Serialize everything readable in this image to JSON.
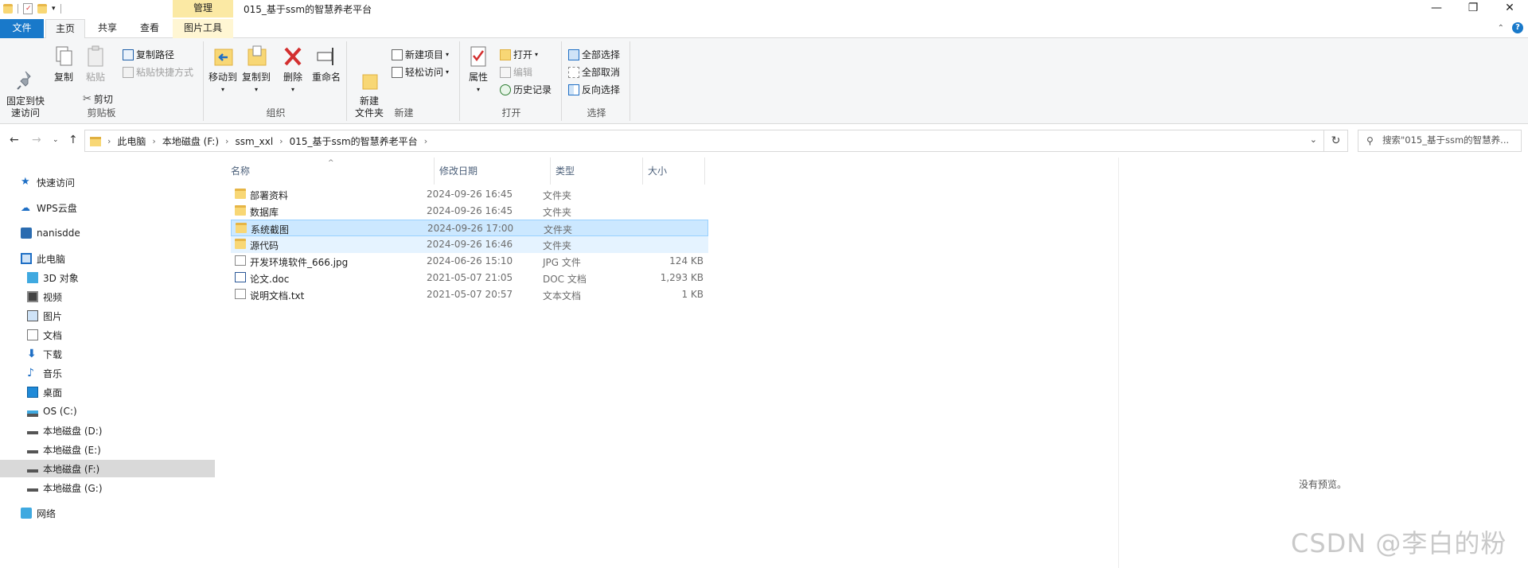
{
  "window": {
    "title": "015_基于ssm的智慧养老平台",
    "context_tab_group": "管理",
    "controls": [
      "—",
      "❐",
      "✕"
    ]
  },
  "tabs": {
    "file": "文件",
    "home": "主页",
    "share": "共享",
    "view": "查看",
    "picture_tools": "图片工具"
  },
  "ribbon": {
    "clipboard": {
      "label": "剪贴板",
      "pin": "固定到快\n速访问",
      "copy": "复制",
      "paste": "粘贴",
      "copy_path": "复制路径",
      "paste_shortcut": "粘贴快捷方式",
      "cut": "剪切"
    },
    "organize": {
      "label": "组织",
      "move_to": "移动到",
      "copy_to": "复制到",
      "delete": "删除",
      "rename": "重命名"
    },
    "new": {
      "label": "新建",
      "new_folder": "新建\n文件夹",
      "new_item": "新建项目",
      "easy_access": "轻松访问"
    },
    "open": {
      "label": "打开",
      "properties": "属性",
      "open": "打开",
      "edit": "编辑",
      "history": "历史记录"
    },
    "select": {
      "label": "选择",
      "select_all": "全部选择",
      "select_none": "全部取消",
      "invert": "反向选择"
    }
  },
  "address": {
    "crumbs": [
      "此电脑",
      "本地磁盘 (F:)",
      "ssm_xxl",
      "015_基于ssm的智慧养老平台"
    ],
    "search_placeholder": "搜索\"015_基于ssm的智慧养..."
  },
  "nav": {
    "items": [
      {
        "label": "快速访问",
        "icon": "star-icon"
      },
      {
        "label": "WPS云盘",
        "icon": "cloud-icon"
      },
      {
        "label": "nanisdde",
        "icon": "user-folder-icon"
      },
      {
        "label": "此电脑",
        "icon": "pc-icon"
      },
      {
        "label": "3D 对象",
        "icon": "3d-icon"
      },
      {
        "label": "视频",
        "icon": "video-icon"
      },
      {
        "label": "图片",
        "icon": "picture-icon"
      },
      {
        "label": "文档",
        "icon": "document-icon"
      },
      {
        "label": "下载",
        "icon": "download-icon"
      },
      {
        "label": "音乐",
        "icon": "music-icon"
      },
      {
        "label": "桌面",
        "icon": "desktop-icon"
      },
      {
        "label": "OS (C:)",
        "icon": "os-drive-icon"
      },
      {
        "label": "本地磁盘 (D:)",
        "icon": "drive-icon"
      },
      {
        "label": "本地磁盘 (E:)",
        "icon": "drive-icon"
      },
      {
        "label": "本地磁盘 (F:)",
        "icon": "drive-icon"
      },
      {
        "label": "本地磁盘 (G:)",
        "icon": "drive-icon"
      },
      {
        "label": "网络",
        "icon": "network-icon"
      }
    ]
  },
  "files": {
    "columns": {
      "name": "名称",
      "date": "修改日期",
      "type": "类型",
      "size": "大小"
    },
    "rows": [
      {
        "name": "部署资料",
        "date": "2024-09-26 16:45",
        "type": "文件夹",
        "size": "",
        "kind": "folder"
      },
      {
        "name": "数据库",
        "date": "2024-09-26 16:45",
        "type": "文件夹",
        "size": "",
        "kind": "folder"
      },
      {
        "name": "系统截图",
        "date": "2024-09-26 17:00",
        "type": "文件夹",
        "size": "",
        "kind": "folder"
      },
      {
        "name": "源代码",
        "date": "2024-09-26 16:46",
        "type": "文件夹",
        "size": "",
        "kind": "folder"
      },
      {
        "name": "开发环境软件_666.jpg",
        "date": "2024-06-26 15:10",
        "type": "JPG 文件",
        "size": "124 KB",
        "kind": "image"
      },
      {
        "name": "论文.doc",
        "date": "2021-05-07 21:05",
        "type": "DOC 文档",
        "size": "1,293 KB",
        "kind": "doc"
      },
      {
        "name": "说明文档.txt",
        "date": "2021-05-07 20:57",
        "type": "文本文档",
        "size": "1 KB",
        "kind": "txt"
      }
    ]
  },
  "preview": {
    "empty_text": "没有预览。"
  },
  "watermark": "CSDN @李白的粉"
}
